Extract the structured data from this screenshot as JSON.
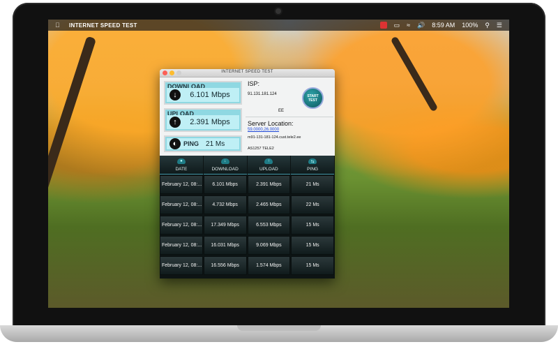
{
  "menubar": {
    "app_name": "INTERNET SPEED TEST",
    "time": "8:59 AM",
    "battery": "100%"
  },
  "window": {
    "title": "INTERNET SPEED TEST"
  },
  "stats": {
    "download_label": "DOWNLOAD",
    "download_value": "6.101 Mbps",
    "upload_label": "UPLOAD",
    "upload_value": "2.391 Mbps",
    "ping_label": "PING",
    "ping_value": "21 Ms"
  },
  "isp": {
    "label": "ISP:",
    "ip": "91.131.181.124",
    "country": "EE"
  },
  "start_button": {
    "label": "START TEST"
  },
  "server": {
    "label": "Server Location:",
    "coords": "59.0000,26.0000",
    "host": "m91-131-181-124.cust.tele2.ee",
    "asn": "AS1257 TELE2"
  },
  "table": {
    "headers": [
      "DATE",
      "DOWNLOAD",
      "UPLOAD",
      "PING"
    ],
    "rows": [
      [
        "February 12, 08:...",
        "6.101 Mbps",
        "2.391 Mbps",
        "21 Ms"
      ],
      [
        "February 12, 08:...",
        "4.732 Mbps",
        "2.465 Mbps",
        "22 Ms"
      ],
      [
        "February 12, 08:...",
        "17.349 Mbps",
        "6.553 Mbps",
        "15 Ms"
      ],
      [
        "February 12, 08:...",
        "16.031 Mbps",
        "9.069 Mbps",
        "15 Ms"
      ],
      [
        "February 12, 08:...",
        "16.556 Mbps",
        "1.574 Mbps",
        "15 Ms"
      ]
    ]
  }
}
